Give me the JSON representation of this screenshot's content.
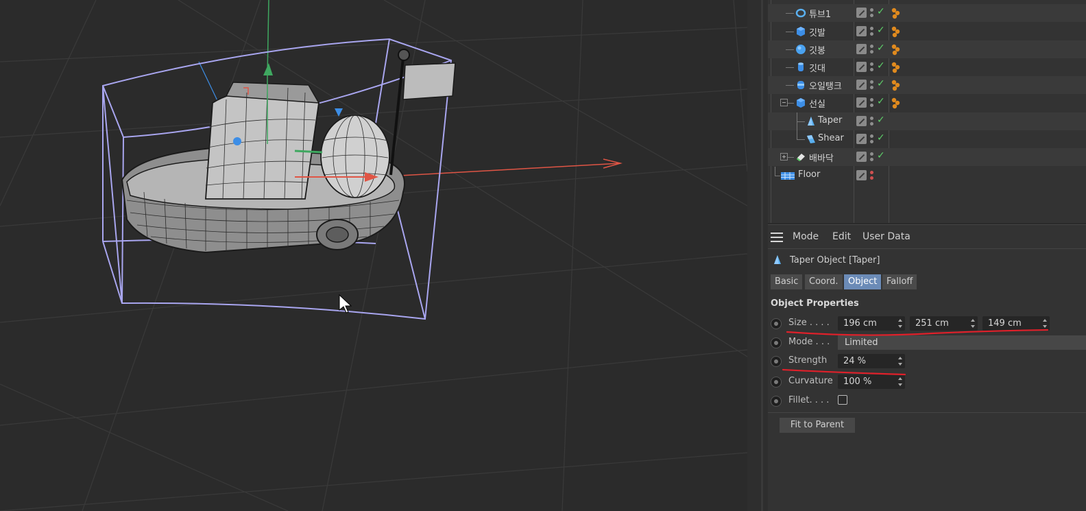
{
  "object_manager": {
    "objects": [
      {
        "name": "튜브1",
        "icon": "tube-icon"
      },
      {
        "name": "깃발",
        "icon": "cube-icon"
      },
      {
        "name": "깃봉",
        "icon": "sphere-icon"
      },
      {
        "name": "깃대",
        "icon": "cylinder-icon"
      },
      {
        "name": "오일탱크",
        "icon": "capsule-icon"
      },
      {
        "name": "선실",
        "icon": "cube-icon"
      },
      {
        "name": "Taper",
        "icon": "taper-deformer-icon"
      },
      {
        "name": "Shear",
        "icon": "shear-deformer-icon"
      },
      {
        "name": "배바닥",
        "icon": "polygon-icon"
      },
      {
        "name": "Floor",
        "icon": "floor-icon"
      }
    ]
  },
  "attribute_manager": {
    "menu": [
      "Mode",
      "Edit",
      "User Data"
    ],
    "title": "Taper Object [Taper]",
    "tabs": [
      "Basic",
      "Coord.",
      "Object",
      "Falloff"
    ],
    "active_tab": "Object",
    "section_title": "Object Properties",
    "size_label": "Size . . . .",
    "size_x": "196 cm",
    "size_y": "251 cm",
    "size_z": "149 cm",
    "mode_label": "Mode . . .",
    "mode_value": "Limited",
    "strength_label": "Strength",
    "strength_value": "24 %",
    "curvature_label": "Curvature",
    "curvature_value": "100 %",
    "fillet_label": "Fillet. . . .",
    "fillet_checked": false,
    "fit_button": "Fit to Parent"
  },
  "colors": {
    "active_tab": "#6b8bb7",
    "check": "#5ecf6a",
    "annotation": "#e0202a",
    "axis_x": "#e05545",
    "axis_y": "#3fa860",
    "axis_z": "#3d8ee6",
    "bounding_box": "#a9a6f0"
  }
}
